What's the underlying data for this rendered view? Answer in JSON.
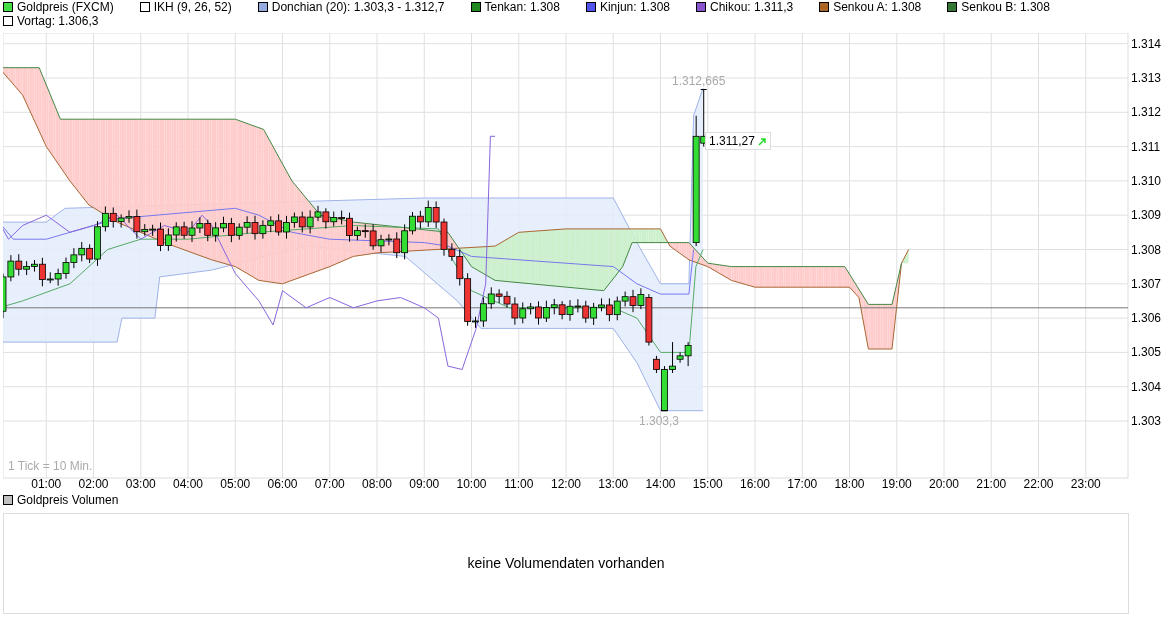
{
  "legend": [
    {
      "label": "Goldpreis (FXCM)",
      "color": "#44dd44"
    },
    {
      "label": "IKH (9, 26, 52)",
      "color": "#ffffff"
    },
    {
      "label": "Donchian (20): 1.303,3 - 1.312,7",
      "color": "#99aadd"
    },
    {
      "label": "Tenkan: 1.308",
      "color": "#228822"
    },
    {
      "label": "Kinjun: 1.308",
      "color": "#5555ee"
    },
    {
      "label": "Chikou: 1.311,3",
      "color": "#8855cc"
    },
    {
      "label": "Senkou A: 1.308",
      "color": "#aa6622"
    },
    {
      "label": "Senkou B: 1.308",
      "color": "#337733"
    },
    {
      "label": "Vortag: 1.306,3",
      "color": "#ffffff"
    }
  ],
  "price_chart": {
    "y_axis_labels": [
      "1.314",
      "1.313",
      "1.312",
      "1.311",
      "1.310",
      "1.309",
      "1.308",
      "1.307",
      "1.306",
      "1.305",
      "1.304",
      "1.303"
    ],
    "x_axis_labels": [
      "01:00",
      "02:00",
      "03:00",
      "04:00",
      "05:00",
      "06:00",
      "07:00",
      "08:00",
      "09:00",
      "10:00",
      "11:00",
      "12:00",
      "13:00",
      "14:00",
      "15:00",
      "16:00",
      "17:00",
      "18:00",
      "19:00",
      "20:00",
      "21:00",
      "22:00",
      "23:00"
    ],
    "tick_note": "1 Tick = 10 Min.",
    "high_label": "1.312,665",
    "low_label": "1.303,3",
    "last_price": "1.311,27"
  },
  "volume": {
    "legend": {
      "label": "Goldpreis Volumen",
      "color": "#c0c0c0"
    },
    "message": "keine Volumendaten vorhanden"
  }
}
